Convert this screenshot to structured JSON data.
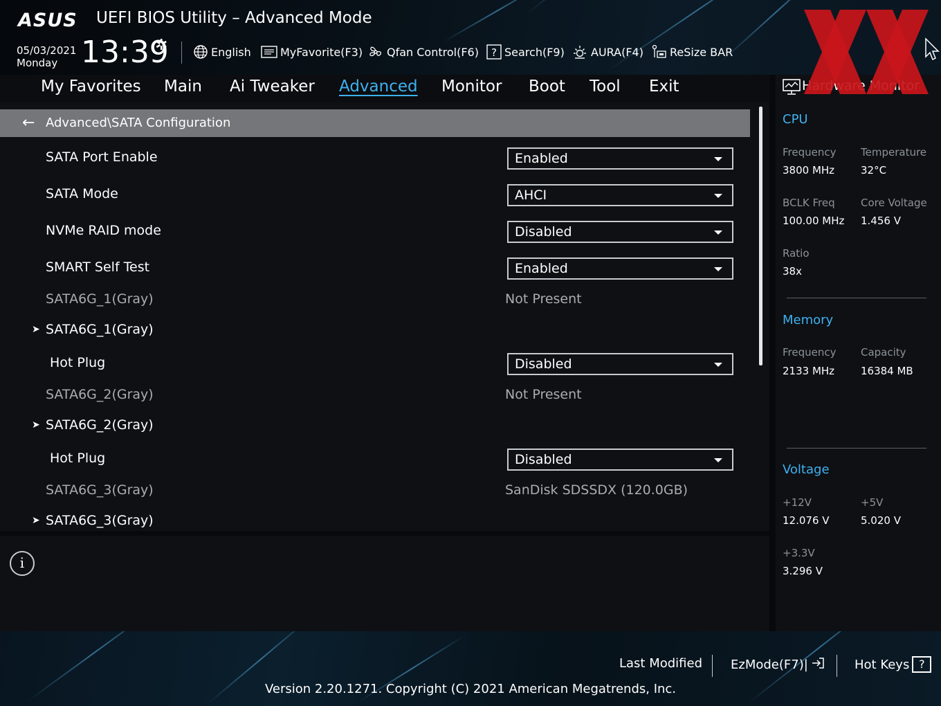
{
  "header": {
    "logo": "ASUS",
    "title": "UEFI BIOS Utility – Advanced Mode",
    "date": "05/03/2021",
    "day": "Monday",
    "time": "13:39",
    "tools": [
      {
        "label": "English",
        "icon": "globe-icon"
      },
      {
        "label": "MyFavorite(F3)",
        "icon": "favorite-list-icon"
      },
      {
        "label": "Qfan Control(F6)",
        "icon": "fan-icon"
      },
      {
        "label": "Search(F9)",
        "icon": "help-search-icon"
      },
      {
        "label": "AURA(F4)",
        "icon": "aura-light-icon"
      },
      {
        "label": "ReSize BAR",
        "icon": "resize-bar-icon"
      }
    ]
  },
  "menu": {
    "items": [
      "My Favorites",
      "Main",
      "Ai Tweaker",
      "Advanced",
      "Monitor",
      "Boot",
      "Tool",
      "Exit"
    ],
    "active": "Advanced"
  },
  "main": {
    "breadcrumb": "Advanced\\SATA Configuration",
    "rows": [
      {
        "label": "SATA Port Enable",
        "value": "Enabled"
      },
      {
        "label": "SATA Mode",
        "value": "AHCI"
      },
      {
        "label": "NVMe RAID mode",
        "value": "Disabled"
      },
      {
        "label": "SMART Self Test",
        "value": "Enabled"
      },
      {
        "label": "SATA6G_1(Gray)",
        "value": "Not Present"
      },
      {
        "label": "SATA6G_1(Gray)"
      },
      {
        "label": "Hot Plug",
        "value": "Disabled"
      },
      {
        "label": "SATA6G_2(Gray)",
        "value": "Not Present"
      },
      {
        "label": "SATA6G_2(Gray)"
      },
      {
        "label": "Hot Plug",
        "value": "Disabled"
      },
      {
        "label": "SATA6G_3(Gray)",
        "value": "SanDisk SDSSDX (120.0GB)"
      },
      {
        "label": "SATA6G_3(Gray)"
      }
    ]
  },
  "hw": {
    "title": "Hardware Monitor",
    "cpu": {
      "title": "CPU",
      "freq_label": "Frequency",
      "freq": "3800 MHz",
      "temp_label": "Temperature",
      "temp": "32°C",
      "bclk_label": "BCLK Freq",
      "bclk": "100.00 MHz",
      "vcore_label": "Core Voltage",
      "vcore": "1.456 V",
      "ratio_label": "Ratio",
      "ratio": "38x"
    },
    "memory": {
      "title": "Memory",
      "freq_label": "Frequency",
      "freq": "2133 MHz",
      "cap_label": "Capacity",
      "cap": "16384 MB"
    },
    "voltage": {
      "title": "Voltage",
      "v12_label": "+12V",
      "v12": "12.076 V",
      "v5_label": "+5V",
      "v5": "5.020 V",
      "v33_label": "+3.3V",
      "v33": "3.296 V"
    }
  },
  "footer": {
    "last_modified": "Last Modified",
    "ezmode": "EzMode(F7)|",
    "hotkeys": "Hot Keys",
    "hotkeys_key": "?",
    "version": "Version 2.20.1271. Copyright (C) 2021 American Megatrends, Inc."
  },
  "colors": {
    "accent": "#3fb1f0",
    "watermark": "#c8151b",
    "breadcrumb_bar": "#747679"
  }
}
